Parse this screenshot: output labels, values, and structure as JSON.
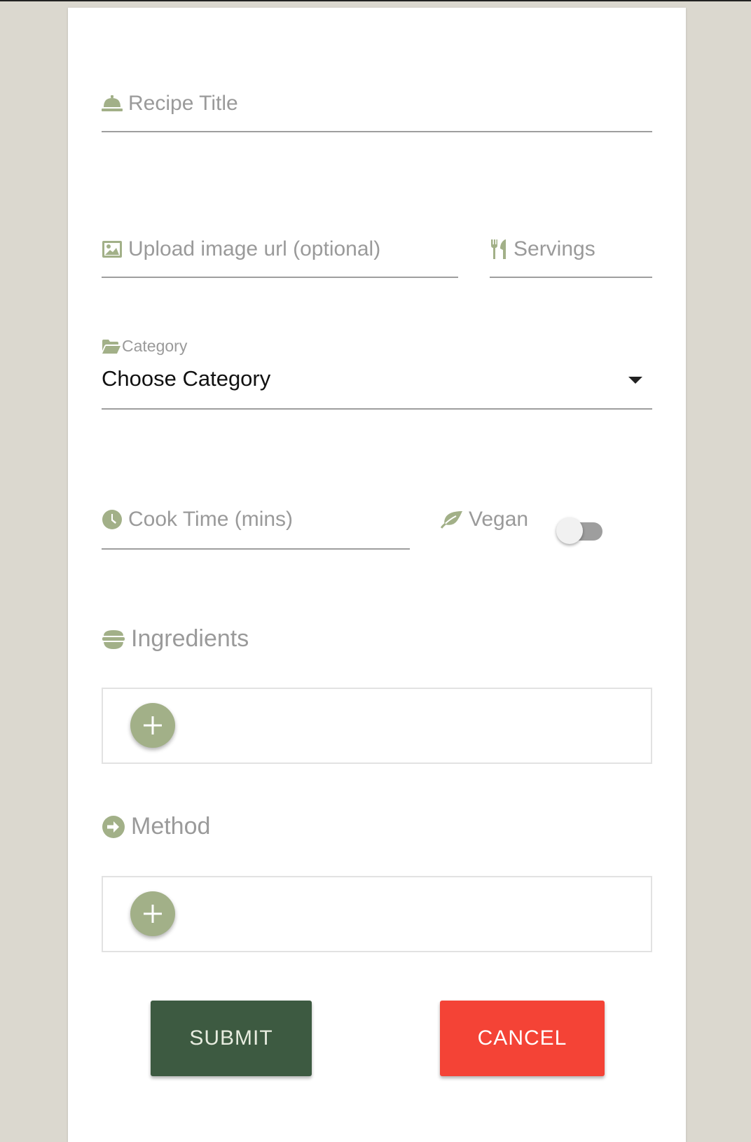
{
  "form": {
    "title_label": "Recipe Title",
    "title_icon": "bell-icon",
    "image_label": "Upload image url (optional)",
    "image_icon": "image-icon",
    "servings_label": "Servings",
    "servings_icon": "utensils-icon",
    "category_label": "Category",
    "category_icon": "folder-open-icon",
    "category_value": "Choose Category",
    "cooktime_label": "Cook Time (mins)",
    "cooktime_icon": "clock-icon",
    "vegan_label": "Vegan",
    "vegan_icon": "leaf-icon",
    "vegan_checked": false
  },
  "ingredients": {
    "title": "Ingredients",
    "icon": "bowl-icon"
  },
  "method": {
    "title": "Method",
    "icon": "arrow-circle-right-icon"
  },
  "actions": {
    "submit_label": "SUBMIT",
    "cancel_label": "CANCEL"
  },
  "colors": {
    "accent": "#a2b088",
    "submit": "#3d5a41",
    "cancel": "#f44336",
    "background": "#dbd8cf"
  }
}
